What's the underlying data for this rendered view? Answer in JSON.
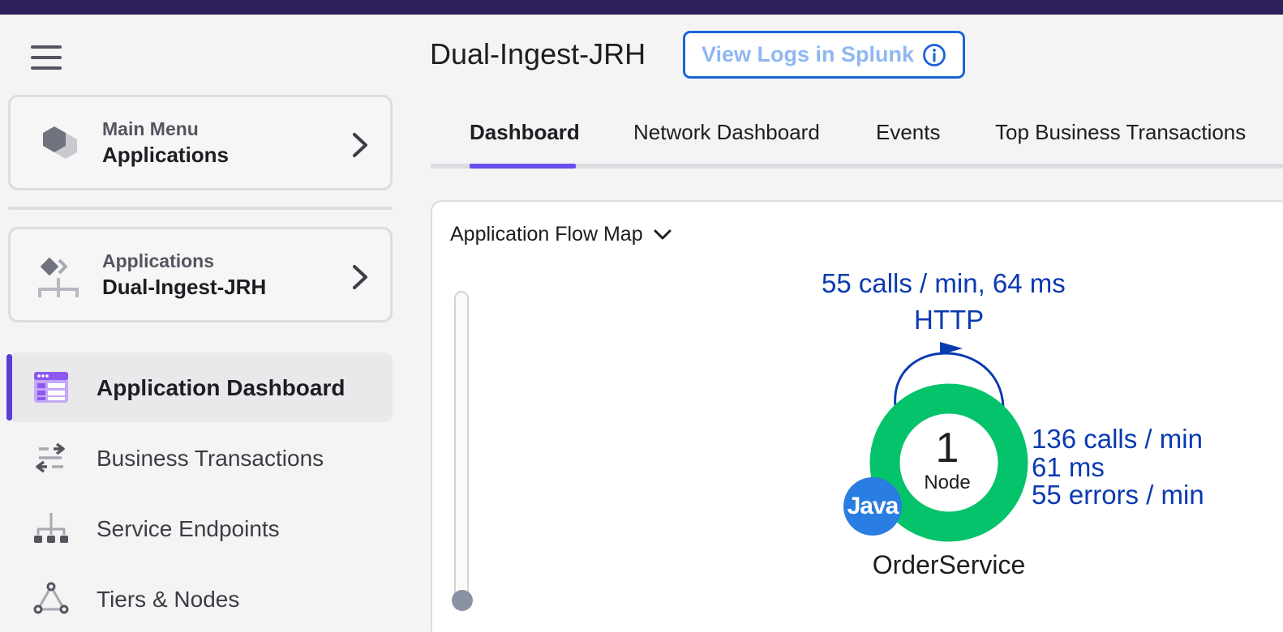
{
  "sidebar": {
    "main_menu": {
      "sup": "Main Menu",
      "title": "Applications"
    },
    "app_card": {
      "sup": "Applications",
      "title": "Dual-Ingest-JRH"
    },
    "items": [
      {
        "label": "Application Dashboard",
        "icon": "dashboard-icon",
        "active": true
      },
      {
        "label": "Business Transactions",
        "icon": "transactions-icon",
        "active": false
      },
      {
        "label": "Service Endpoints",
        "icon": "endpoints-icon",
        "active": false
      },
      {
        "label": "Tiers & Nodes",
        "icon": "tiers-icon",
        "active": false
      }
    ]
  },
  "header": {
    "title": "Dual-Ingest-JRH",
    "splunk_button": "View Logs in Splunk"
  },
  "tabs": [
    {
      "label": "Dashboard",
      "active": true
    },
    {
      "label": "Network Dashboard",
      "active": false
    },
    {
      "label": "Events",
      "active": false
    },
    {
      "label": "Top Business Transactions",
      "active": false
    }
  ],
  "flow_map": {
    "title": "Application Flow Map",
    "edge": {
      "stats": "55 calls / min, 64 ms",
      "protocol": "HTTP"
    },
    "node": {
      "count": "1",
      "count_label": "Node",
      "name": "OrderService",
      "agent": "Java",
      "calls": "136 calls / min",
      "latency": "61 ms",
      "errors": "55 errors / min"
    }
  },
  "colors": {
    "accent": "#6b4ef0",
    "topbar": "#2d1f5a",
    "health_ring": "#05c36b",
    "flow_text": "#0a3ab0",
    "java_badge": "#2a7de1"
  }
}
